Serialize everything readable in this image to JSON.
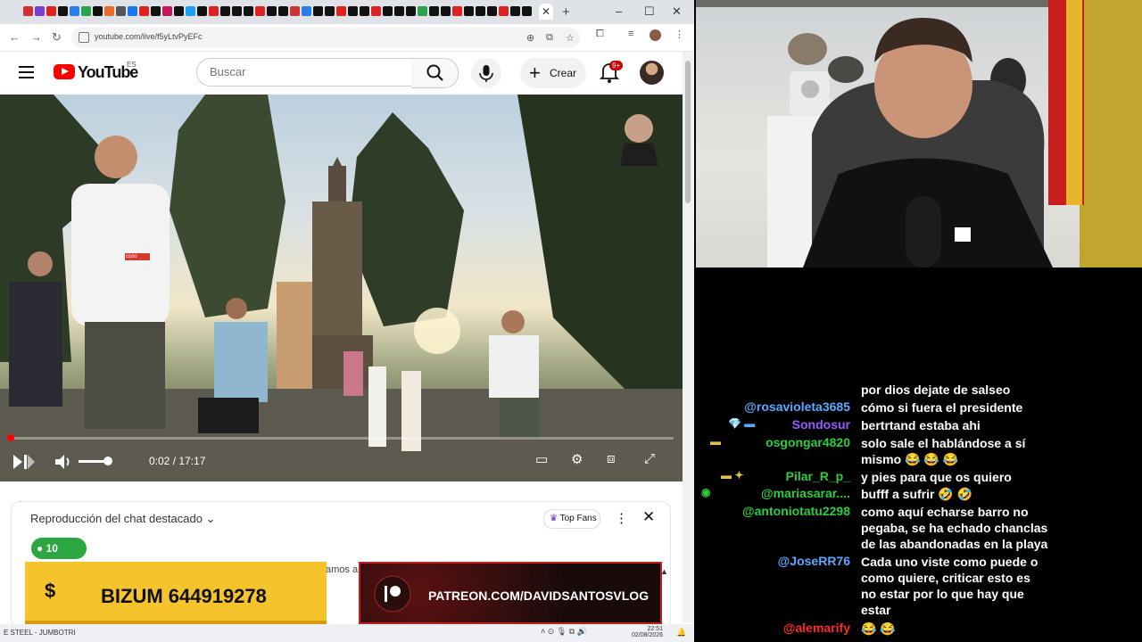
{
  "browser": {
    "url": "youtube.com/live/f5yLtvPyEFc",
    "window_controls": [
      "–",
      "☐",
      "✕"
    ]
  },
  "youtube": {
    "logo_text": "YouTube",
    "country": "ES",
    "search_placeholder": "Buscar",
    "create_label": "Crear",
    "notifications_badge": "9+"
  },
  "video": {
    "time": "0:02 / 17:17",
    "progress_fraction": 0.002,
    "volume_fraction": 0.85,
    "shirt_text": "ccoo"
  },
  "chat_panel": {
    "title": "Reproducción del chat destacado",
    "top_fans_label": "Top Fans",
    "members_count": "10",
    "partial_text": "amos a"
  },
  "overlays": {
    "bizum_label": "BIZUM 644919278",
    "bizum_symbol": "$",
    "patreon_label": "PATREON.COM/DAVIDSANTOSVLOG"
  },
  "taskbar": {
    "title": "E STEEL - JUMBOTRI",
    "time": "22:51",
    "date": "02/08/2026"
  },
  "stream_chat": {
    "messages": [
      {
        "user": "@rosavioleta3685",
        "color": "#5ea8ff",
        "lines": [
          "por dios dejate de salseo",
          "",
          "cómo si fuera el presidente",
          "bertrtand estaba ahi"
        ]
      },
      {
        "user": "Sondosur",
        "color": "#9b59ff"
      },
      {
        "user": "osgongar4820",
        "color": "#2ecc40",
        "lines": [
          "solo sale el hablándose a sí",
          "mismo 😂 😂 😂"
        ]
      },
      {
        "user": "Pilar_R_p_",
        "color": "#2ecc40",
        "lines": [
          "y pies para que os quiero"
        ]
      },
      {
        "user": "@mariasarar....",
        "color": "#2ecc40",
        "lines": [
          "bufff a sufrir 🤣 🤣"
        ]
      },
      {
        "user": "@antoniotatu2298",
        "color": "#2ecc40",
        "lines": [
          "como aquí echarse barro no",
          "pegaba, se ha echado chanclas",
          "de las abandonadas en la playa"
        ]
      },
      {
        "user": "@JoseRR76",
        "color": "#5ea8ff",
        "lines": [
          "Cada uno viste como puede o",
          "como quiere, criticar esto es",
          "no estar por lo que hay que",
          "estar"
        ]
      },
      {
        "user": "@alemarify",
        "color": "#ff2b2b",
        "lines": [
          "😂 😂"
        ]
      }
    ]
  }
}
